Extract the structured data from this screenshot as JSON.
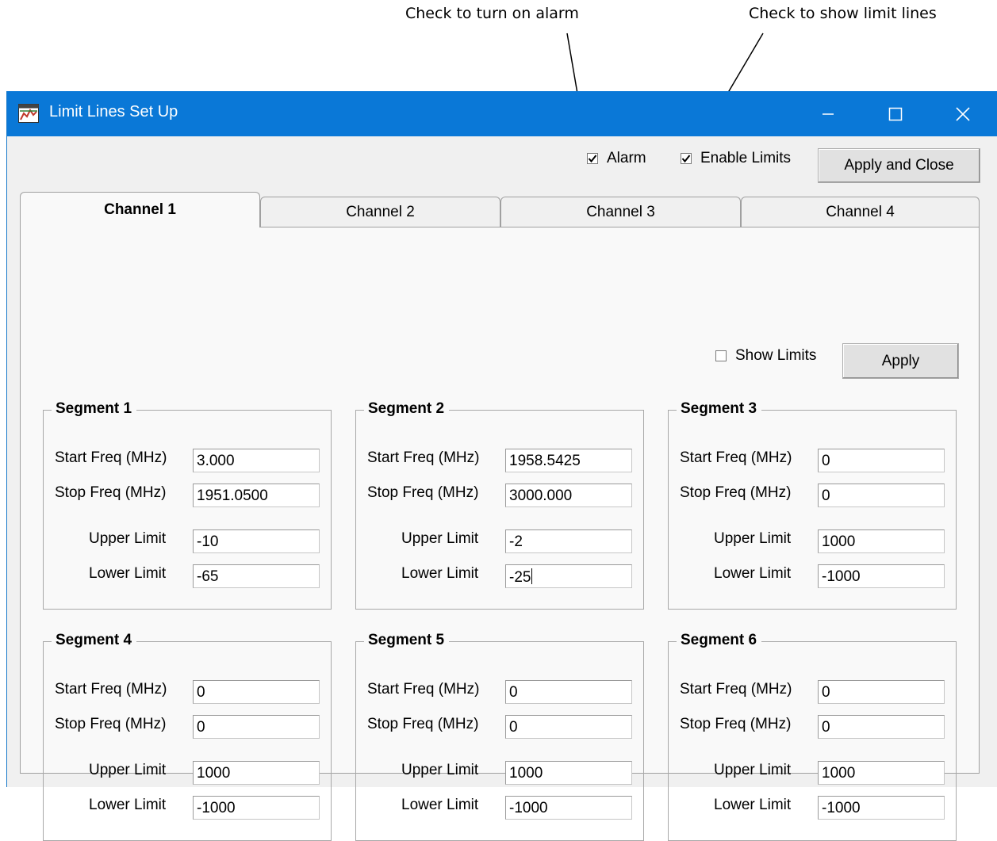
{
  "callouts": {
    "alarm": "Check to turn on alarm",
    "limits": "Check to show limit lines"
  },
  "window": {
    "title": "Limit Lines Set Up"
  },
  "toolbar": {
    "alarm_label": "Alarm",
    "alarm_checked": true,
    "enable_limits_label": "Enable Limits",
    "enable_limits_checked": true,
    "apply_close_label": "Apply and Close"
  },
  "tabs": [
    {
      "label": "Channel 1",
      "active": true
    },
    {
      "label": "Channel 2",
      "active": false
    },
    {
      "label": "Channel 3",
      "active": false
    },
    {
      "label": "Channel 4",
      "active": false
    }
  ],
  "panel": {
    "show_limits_label": "Show Limits",
    "show_limits_checked": false,
    "apply_label": "Apply"
  },
  "field_labels": {
    "start": "Start Freq (MHz)",
    "stop": "Stop Freq (MHz)",
    "upper": "Upper Limit",
    "lower": "Lower Limit"
  },
  "segments": [
    {
      "title": "Segment 1",
      "start": "3.000",
      "stop": "1951.0500",
      "upper": "-10",
      "lower": "-65"
    },
    {
      "title": "Segment 2",
      "start": "1958.5425",
      "stop": "3000.000",
      "upper": "-2",
      "lower": "-25"
    },
    {
      "title": "Segment 3",
      "start": "0",
      "stop": "0",
      "upper": "1000",
      "lower": "-1000"
    },
    {
      "title": "Segment 4",
      "start": "0",
      "stop": "0",
      "upper": "1000",
      "lower": "-1000"
    },
    {
      "title": "Segment 5",
      "start": "0",
      "stop": "0",
      "upper": "1000",
      "lower": "-1000"
    },
    {
      "title": "Segment 6",
      "start": "0",
      "stop": "0",
      "upper": "1000",
      "lower": "-1000"
    }
  ],
  "colors": {
    "titlebar": "#0a78d7",
    "dialog_bg": "#f0f0f0",
    "panel_bg": "#f9f9f9"
  },
  "icons": {
    "app": "limit-lines-app-icon",
    "minimize": "minimize-icon",
    "maximize": "maximize-icon",
    "close": "close-icon",
    "check": "checkmark-icon"
  }
}
